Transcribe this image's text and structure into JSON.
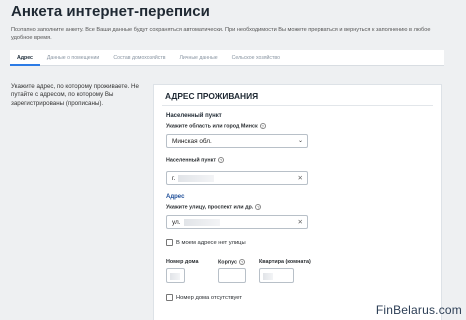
{
  "page": {
    "title": "Анкета интернет-переписи",
    "subtitle": "Поэтапно заполните анкету. Все Ваши данные будут сохраняться автоматически. При необходимости Вы можете прерваться и вернуться к заполнению в любое удобное время."
  },
  "tabs": [
    {
      "label": "Адрес",
      "active": true
    },
    {
      "label": "Данные о помещении",
      "active": false
    },
    {
      "label": "Состав домохозяйств",
      "active": false
    },
    {
      "label": "Личные данные",
      "active": false
    },
    {
      "label": "Сельское хозяйство",
      "active": false
    }
  ],
  "hint": "Укажите адрес, по которому проживаете. Не путайте с адресом, по которому Вы зарегистрированы (прописаны).",
  "card": {
    "title": "АДРЕС ПРОЖИВАНИЯ",
    "settlement_group": "Населенный пункт",
    "region_label": "Укажите область или город Минск",
    "region_value": "Минская обл.",
    "settlement_label": "Населенный пункт",
    "settlement_prefix": "г.",
    "address_group": "Адрес",
    "street_label": "Укажите улицу, проспект или др.",
    "street_prefix": "ул.",
    "no_street_label": "В моем адресе нет улицы",
    "house_label": "Номер дома",
    "building_label": "Корпус",
    "apartment_label": "Квартира (комната)",
    "no_house_label": "Номер дома отсутствует"
  },
  "icons": {
    "info": "info-icon",
    "chevron": "chevron-down-icon",
    "clear": "clear-icon"
  },
  "watermark": "FinBelarus.com",
  "colors": {
    "accent": "#2c7be5",
    "group_title": "#1f4f99",
    "background": "#eef0f2"
  }
}
